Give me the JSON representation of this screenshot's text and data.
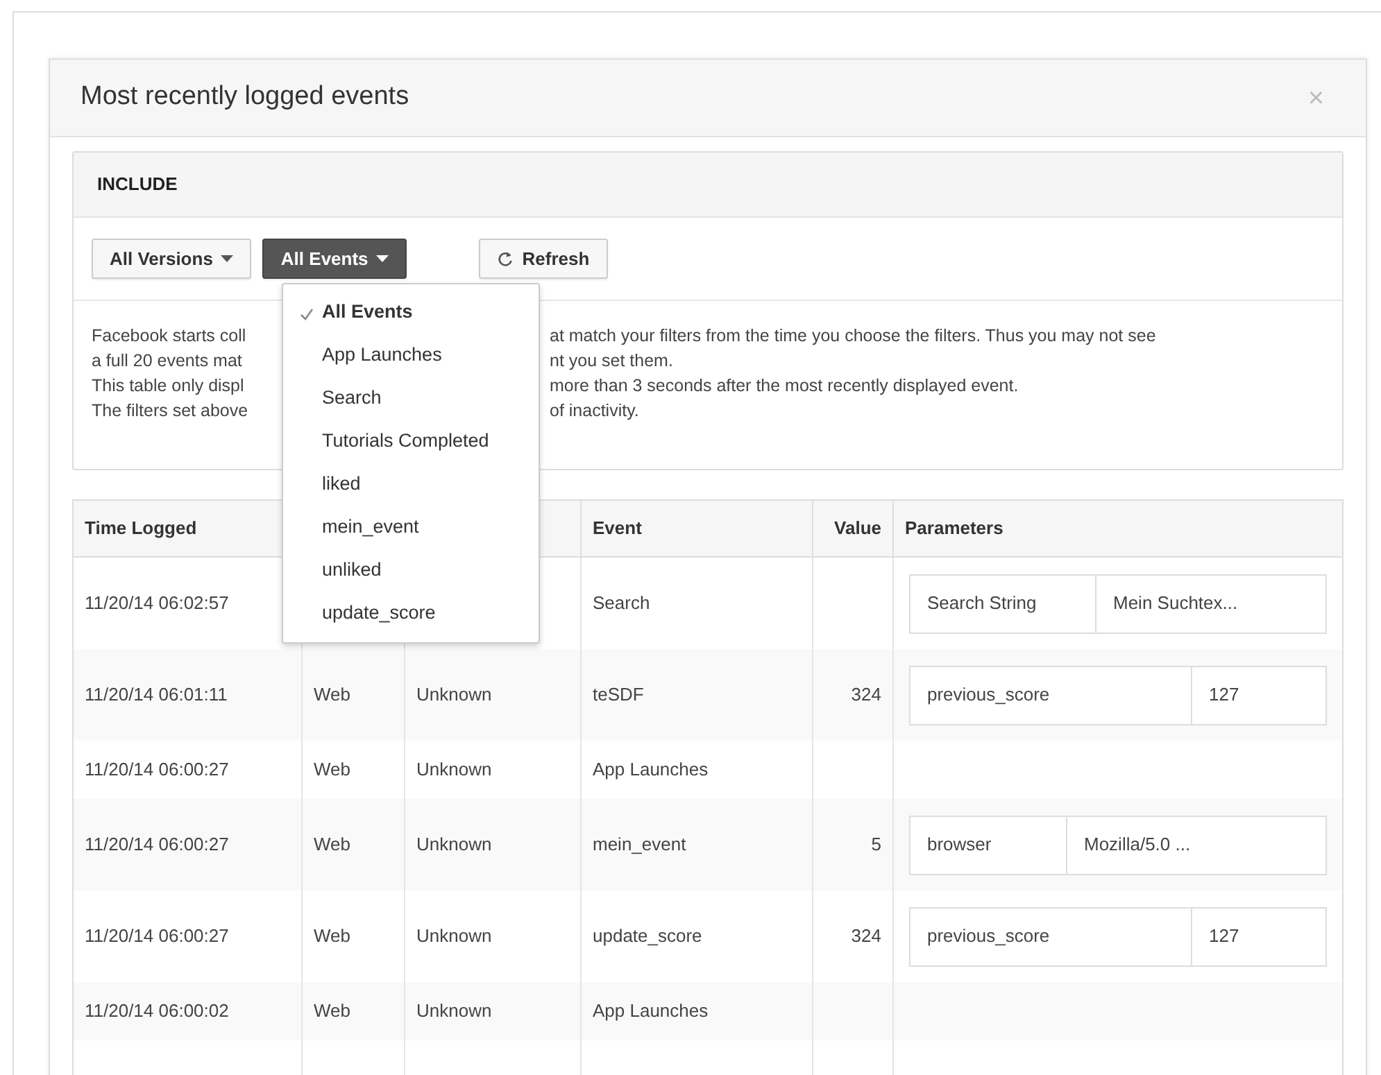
{
  "dialog": {
    "title": "Most recently logged events",
    "close": "×"
  },
  "include": {
    "heading": "INCLUDE",
    "filters": [
      {
        "label": "All Versions",
        "kind": "dropdown",
        "active": false
      },
      {
        "label": "All Events",
        "kind": "dropdown",
        "active": true
      },
      {
        "label": "Refresh",
        "kind": "refresh",
        "active": false
      }
    ],
    "info_lines": [
      {
        "left": "Facebook starts coll",
        "right": "at match your filters from the time you choose the filters. Thus you may not see"
      },
      {
        "left": "a full 20 events mat",
        "right": "nt you set them."
      },
      {
        "left": "This table only displ",
        "right": "more than 3 seconds after the most recently displayed event."
      },
      {
        "left": "The filters set above",
        "right": "of inactivity."
      }
    ]
  },
  "events_menu": {
    "items": [
      {
        "label": "All Events",
        "selected": true
      },
      {
        "label": "App Launches",
        "selected": false
      },
      {
        "label": "Search",
        "selected": false
      },
      {
        "label": "Tutorials Completed",
        "selected": false
      },
      {
        "label": "liked",
        "selected": false
      },
      {
        "label": "mein_event",
        "selected": false
      },
      {
        "label": "unliked",
        "selected": false
      },
      {
        "label": "update_score",
        "selected": false
      }
    ]
  },
  "table": {
    "columns": [
      "Time Logged",
      "",
      "",
      "Event",
      "Value",
      "Parameters"
    ],
    "rows": [
      {
        "time": "11/20/14 06:02:57",
        "column_2": "",
        "column_3": "",
        "event": "Search",
        "value": "",
        "params": [
          {
            "key": "Search String",
            "value": "Mein Suchtex..."
          }
        ]
      },
      {
        "time": "11/20/14 06:01:11",
        "column_2": "Web",
        "column_3": "Unknown",
        "event": "teSDF",
        "value": "324",
        "params": [
          {
            "key": "previous_score",
            "value": "127"
          }
        ]
      },
      {
        "time": "11/20/14 06:00:27",
        "column_2": "Web",
        "column_3": "Unknown",
        "event": "App Launches",
        "value": "",
        "params": []
      },
      {
        "time": "11/20/14 06:00:27",
        "column_2": "Web",
        "column_3": "Unknown",
        "event": "mein_event",
        "value": "5",
        "params": [
          {
            "key": "browser",
            "value": "Mozilla/5.0 ..."
          }
        ]
      },
      {
        "time": "11/20/14 06:00:27",
        "column_2": "Web",
        "column_3": "Unknown",
        "event": "update_score",
        "value": "324",
        "params": [
          {
            "key": "previous_score",
            "value": "127"
          }
        ]
      },
      {
        "time": "11/20/14 06:00:02",
        "column_2": "Web",
        "column_3": "Unknown",
        "event": "App Launches",
        "value": "",
        "params": []
      }
    ]
  }
}
